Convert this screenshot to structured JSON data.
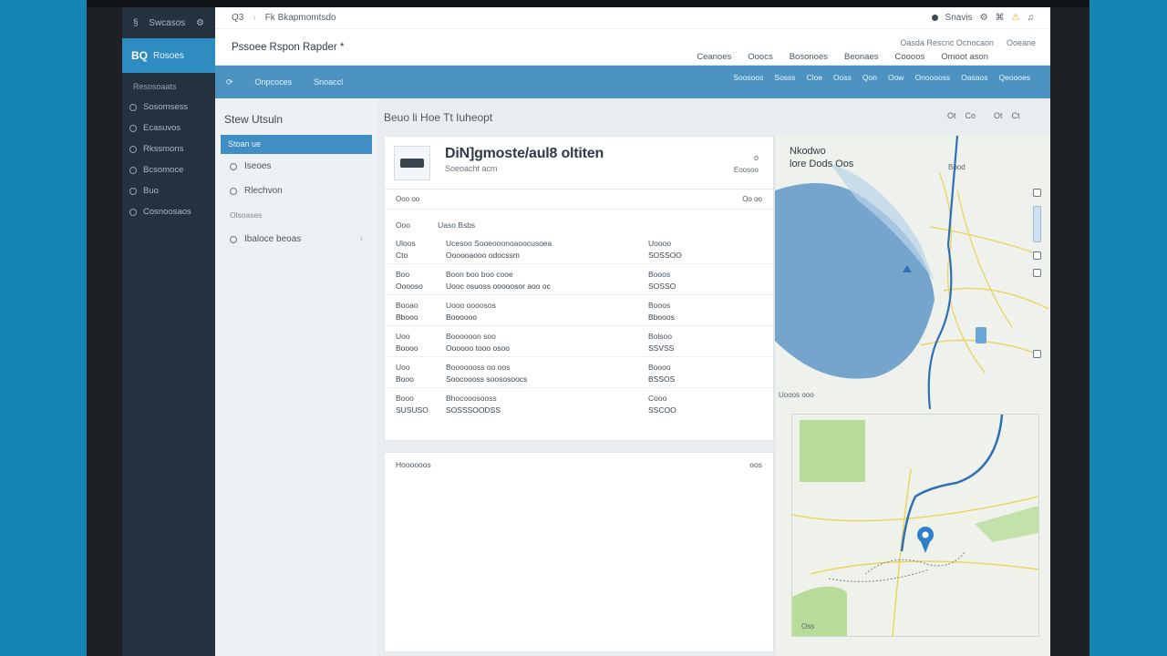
{
  "topbar": {
    "crumb_num": "Q3",
    "crumb_label": "Fk Bkapmomtsdo",
    "user": "Snavis"
  },
  "nav": {
    "top_label": "Swcasos",
    "brand": "Rosoes",
    "brand_logo": "BQ",
    "sub": "Resosoaats",
    "items": [
      {
        "label": "Sosomsess"
      },
      {
        "label": "Ecasuvos"
      },
      {
        "label": "Rkssmons"
      },
      {
        "label": "Bcsomoce"
      },
      {
        "label": "Buo"
      },
      {
        "label": "Cosnoosaos"
      }
    ]
  },
  "header": {
    "title": "Pssoee Rspon Rapder *",
    "right_top": [
      "Oasda Rescnc Ocnocaon",
      "Ooeane"
    ],
    "links": [
      "Ceanoes",
      "Ooocs",
      "Bosonoes",
      "Beonaes",
      "Coooos",
      "Omoot ason"
    ]
  },
  "bluebar": {
    "crumb1": "Onpcoces",
    "crumb2": "Snoaccl",
    "filters": [
      "Soosoos",
      "Sosss",
      "Cloe",
      "Ooss",
      "Qon",
      "Oow",
      "Onooooss",
      "Oasaos",
      "Qeoooes"
    ]
  },
  "subnav": {
    "heading": "Stew Utsuln",
    "active": "Stoan ue",
    "items": [
      {
        "label": "Iseoes"
      },
      {
        "label": "Rlechvon"
      }
    ],
    "group": "Olsoases",
    "extra_item": "Ibaloce beoas"
  },
  "page": {
    "title": "Beuo li Hoe Tt Iuheopt",
    "tools": [
      "Ot",
      "Co",
      "Ot",
      "Ct"
    ]
  },
  "card": {
    "title": "DiN]gmoste/aul8 oltiten",
    "subtitle": "Soeoacht acm",
    "btn": "o",
    "more": "Eoosoo",
    "section_left": "Ooo oo",
    "section_right": "Oo oo",
    "kv": {
      "k": "Ooo",
      "v": "Uaso Bsbs"
    },
    "rows": [
      {
        "c1a": "Uloos",
        "c1b": "Cto",
        "c2a": "Ucesoo Sooeooonoaoocusoea",
        "c2b": "Oooooaooo odocssm",
        "c3a": "Uoooo",
        "c3b": "SOSSOO"
      },
      {
        "c1a": "Boo",
        "c1b": "Ooooso",
        "c2a": "Boon boo boo cooe",
        "c2b": "Uooc osuoss ooooosor aoo oc",
        "c3a": "Booos",
        "c3b": "SOSSO"
      },
      {
        "c1a": "Booao",
        "c1b": "Bbooo",
        "c2a": "Uooo oooosos",
        "c2b": "Boooooo",
        "c3a": "Booos",
        "c3b": "Bbooos"
      },
      {
        "c1a": "Uoo",
        "c1b": "Boooo",
        "c2a": "Boooooon soo",
        "c2b": "Oooooo tooo osoo",
        "c3a": "Bolsoo",
        "c3b": "SSVSS"
      },
      {
        "c1a": "Uoo",
        "c1b": "Booo",
        "c2a": "Booooooss oo oos",
        "c2b": "Soocoooss soososoocs",
        "c3a": "Boooo",
        "c3b": "BSSOS"
      },
      {
        "c1a": "Booo",
        "c1b": "SUSUSO",
        "c2a": "Bhocooosooss",
        "c2b": "SOSSSOODSS",
        "c3a": "Cooo",
        "c3b": "SSCOO"
      }
    ]
  },
  "card2": {
    "title": "Hoooooos",
    "action": "oos"
  },
  "map": {
    "title_line1": "Nkodwo",
    "title_line2": "lore Dods Oos",
    "labels": {
      "top_right": "Bood",
      "left": "Uooos ooo",
      "bottom_left": "Oss"
    },
    "colors": {
      "water": "#5f97c8",
      "route": "#2e6fb8",
      "road": "#e9d35a",
      "park": "#b8dc9a",
      "pin": "#2f80c8"
    }
  }
}
